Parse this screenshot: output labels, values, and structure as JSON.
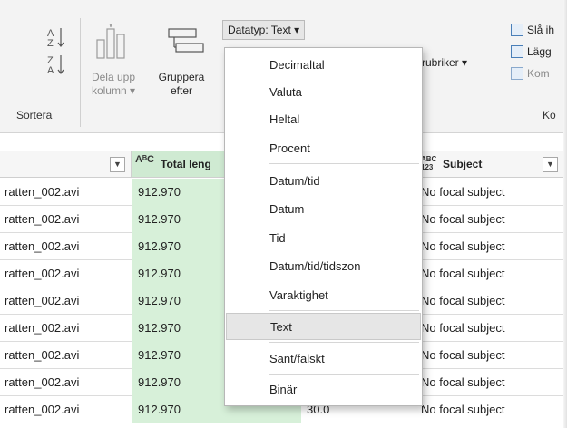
{
  "ribbon": {
    "sort_label": "Sortera",
    "split_label_line1": "Dela upp",
    "split_label_line2": "kolumn",
    "group_label_line1": "Gruppera",
    "group_label_line2": "efter",
    "datatype_label": "Datatyp: Text",
    "rubriker_label": "rubriker",
    "right_items": [
      "Slå ih",
      "Lägg",
      "Kom"
    ],
    "right_group_label": "Ko"
  },
  "table": {
    "columns": [
      {
        "title": "",
        "type_icon": ""
      },
      {
        "title": "Total leng",
        "type_icon": "AᴮC"
      },
      {
        "title": "",
        "type_icon": ""
      },
      {
        "title": "Subject",
        "type_icon": "ABC 123"
      }
    ],
    "rows": [
      {
        "c1": "ratten_002.avi",
        "c2": "912.970",
        "c3": "",
        "c4": "No focal subject"
      },
      {
        "c1": "ratten_002.avi",
        "c2": "912.970",
        "c3": "",
        "c4": "No focal subject"
      },
      {
        "c1": "ratten_002.avi",
        "c2": "912.970",
        "c3": "",
        "c4": "No focal subject"
      },
      {
        "c1": "ratten_002.avi",
        "c2": "912.970",
        "c3": "",
        "c4": "No focal subject"
      },
      {
        "c1": "ratten_002.avi",
        "c2": "912.970",
        "c3": "",
        "c4": "No focal subject"
      },
      {
        "c1": "ratten_002.avi",
        "c2": "912.970",
        "c3": "",
        "c4": "No focal subject"
      },
      {
        "c1": "ratten_002.avi",
        "c2": "912.970",
        "c3": "",
        "c4": "No focal subject"
      },
      {
        "c1": "ratten_002.avi",
        "c2": "912.970",
        "c3": "",
        "c4": "No focal subject"
      },
      {
        "c1": "ratten_002.avi",
        "c2": "912.970",
        "c3": "30.0",
        "c4": "No focal subject"
      }
    ]
  },
  "menu": {
    "items": [
      {
        "label": "Decimaltal"
      },
      {
        "label": "Valuta"
      },
      {
        "label": "Heltal"
      },
      {
        "label": "Procent"
      },
      {
        "label": "Datum/tid"
      },
      {
        "label": "Datum"
      },
      {
        "label": "Tid"
      },
      {
        "label": "Datum/tid/tidszon"
      },
      {
        "label": "Varaktighet"
      },
      {
        "label": "Text"
      },
      {
        "label": "Sant/falskt"
      },
      {
        "label": "Binär"
      }
    ],
    "selected": "Text"
  },
  "colors": {
    "highlight_column": "#d7f0d9",
    "ribbon_bg": "#f3f3f3",
    "menu_selected": "#e6e6e6"
  }
}
